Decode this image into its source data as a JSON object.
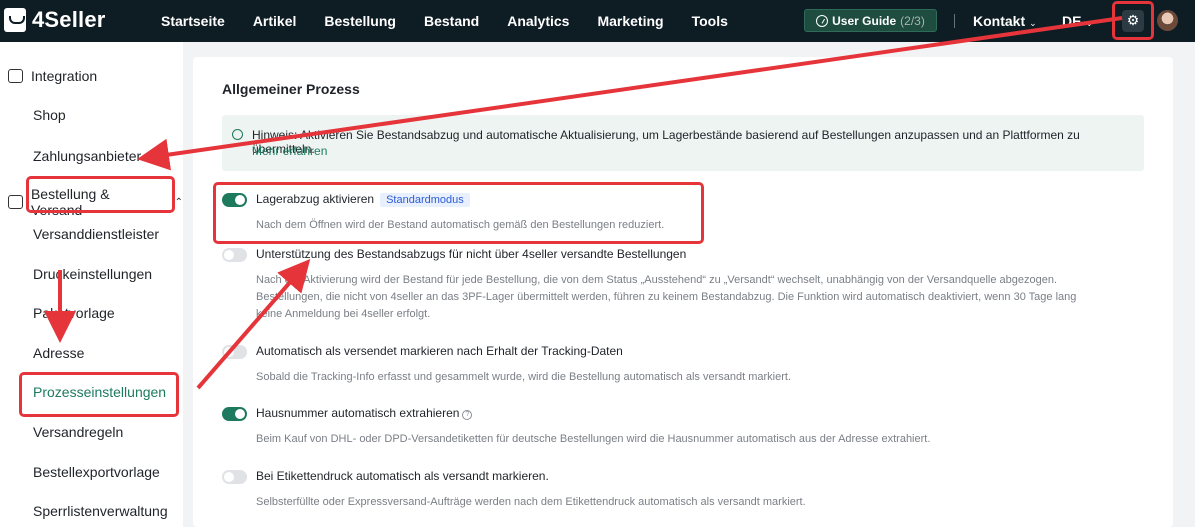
{
  "app": {
    "logo_text": "4Seller"
  },
  "nav": [
    "Startseite",
    "Artikel",
    "Bestellung",
    "Bestand",
    "Analytics",
    "Marketing",
    "Tools"
  ],
  "header": {
    "guide_label": "User Guide",
    "guide_count": "(2/3)",
    "contact": "Kontakt",
    "language": "DE"
  },
  "sidebar": {
    "integration": "Integration",
    "shop": "Shop",
    "payment": "Zahlungsanbieter",
    "order_shipping": "Bestellung & Versand",
    "items": [
      "Versanddienstleister",
      "Druckeinstellungen",
      "Paketvorlage",
      "Adresse",
      "Prozesseinstellungen",
      "Versandregeln",
      "Bestellexportvorlage",
      "Sperrlistenverwaltung"
    ]
  },
  "main": {
    "title": "Allgemeiner Prozess",
    "notice_text": "Hinweis: Aktivieren Sie Bestandsabzug und automatische Aktualisierung, um Lagerbestände basierend auf Bestellungen anzupassen und an Plattformen zu übermitteln.",
    "notice_link": "Mehr erfahren",
    "settings": [
      {
        "title": "Lagerabzug aktivieren",
        "badge": "Standardmodus",
        "enabled": true,
        "desc": [
          "Nach dem Öffnen wird der Bestand automatisch gemäß den Bestellungen reduziert."
        ]
      },
      {
        "title": "Unterstützung des Bestandsabzugs für nicht über 4seller versandte Bestellungen",
        "enabled": false,
        "desc": [
          "Nach der Aktivierung wird der Bestand für jede Bestellung, die von dem Status „Ausstehend“ zu „Versandt“ wechselt, unabhängig von der Versandquelle abgezogen.",
          "Bestellungen, die nicht von 4seller an das 3PF-Lager übermittelt werden, führen zu keinem Bestandabzug. Die Funktion wird automatisch deaktiviert, wenn 30 Tage lang",
          "keine Anmeldung bei 4seller erfolgt."
        ]
      },
      {
        "title": "Automatisch als versendet markieren nach Erhalt der Tracking-Daten",
        "enabled": false,
        "desc": [
          "Sobald die Tracking-Info erfasst und gesammelt wurde, wird die Bestellung automatisch als versandt markiert."
        ]
      },
      {
        "title": "Hausnummer automatisch extrahieren",
        "enabled": true,
        "help": "?",
        "desc": [
          "Beim Kauf von DHL- oder DPD-Versandetiketten für deutsche Bestellungen wird die Hausnummer automatisch aus der Adresse extrahiert."
        ]
      },
      {
        "title": "Bei Etikettendruck automatisch als versandt markieren.",
        "enabled": false,
        "desc": [
          "Selbsterfüllte oder Expressversand-Aufträge werden nach dem Etikettendruck automatisch als versandt markiert."
        ]
      }
    ]
  },
  "colors": {
    "accent": "#1d7a5f",
    "topbar": "#0e1c24",
    "annotation": "#e5343a"
  }
}
